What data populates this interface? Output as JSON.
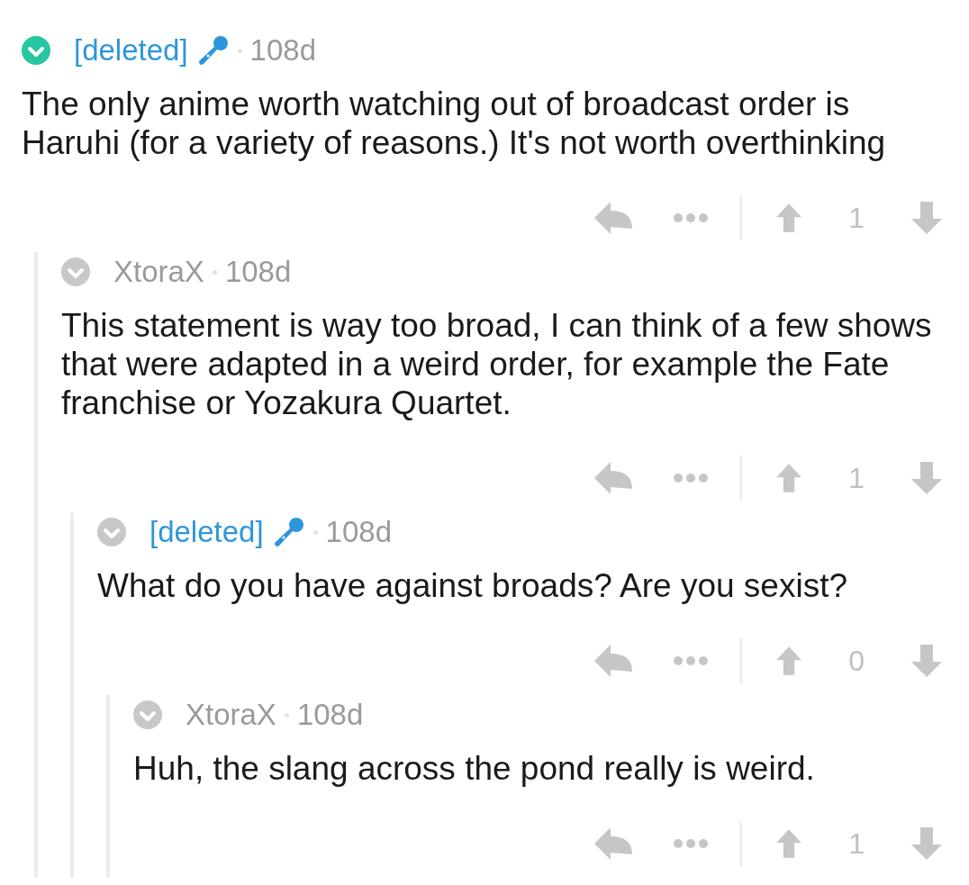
{
  "comments": [
    {
      "username": "[deleted]",
      "submitter": true,
      "color": "#26c6a0",
      "age": "108d",
      "body": "The only anime worth watching out of broadcast order is Haruhi (for a variety of reasons.) It's not worth overthinking",
      "score": "1",
      "children": [
        {
          "username": "XtoraX",
          "submitter": false,
          "color": "#c8c8c8",
          "age": "108d",
          "body": "This statement is way too broad, I can think of a few shows that were adapted in a weird order, for example the Fate franchise or Yozakura Quartet.",
          "score": "1",
          "children": [
            {
              "username": "[deleted]",
              "submitter": true,
              "color": "#c8c8c8",
              "age": "108d",
              "body": "What do you have against broads? Are you sexist?",
              "score": "0",
              "children": [
                {
                  "username": "XtoraX",
                  "submitter": false,
                  "color": "#c8c8c8",
                  "age": "108d",
                  "body": "Huh, the slang across the pond really is weird.",
                  "score": "1"
                }
              ]
            }
          ]
        }
      ]
    }
  ]
}
